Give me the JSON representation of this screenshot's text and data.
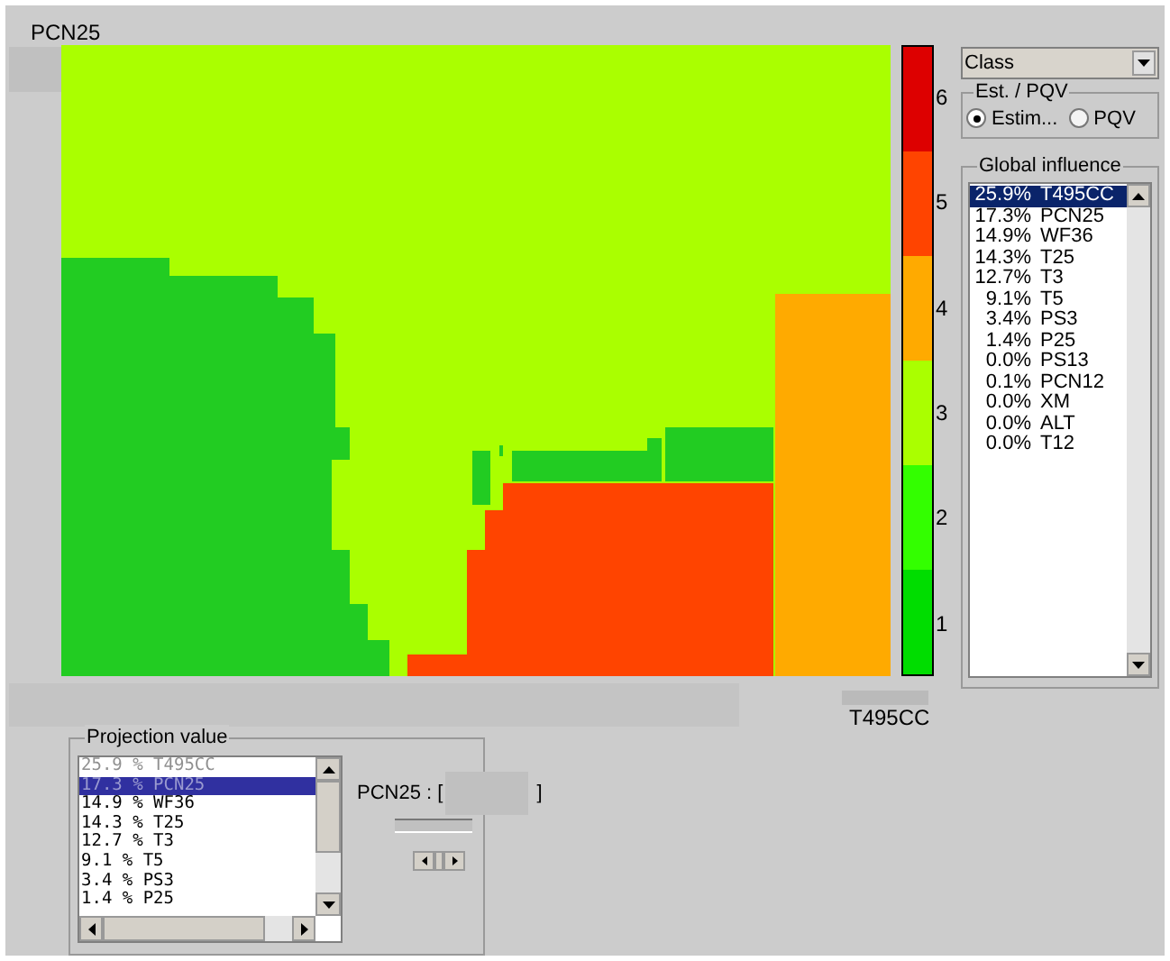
{
  "title": "PCN25",
  "x_axis_label": "T495CC",
  "legend": [
    {
      "label": "6",
      "color": "#dd0000"
    },
    {
      "label": "5",
      "color": "#ff4400"
    },
    {
      "label": "4",
      "color": "#ffaa00"
    },
    {
      "label": "3",
      "color": "#aaff00"
    },
    {
      "label": "2",
      "color": "#33ff00"
    },
    {
      "label": "1",
      "color": "#00dd00"
    }
  ],
  "class_dropdown": {
    "value": "Class"
  },
  "est_pqv": {
    "title": "Est. / PQV",
    "options": [
      {
        "label": "Estim...",
        "selected": true
      },
      {
        "label": "PQV",
        "selected": false
      }
    ]
  },
  "global_influence": {
    "title": "Global influence",
    "items": [
      {
        "percent": "25.9%",
        "name": "T495CC",
        "selected": true
      },
      {
        "percent": "17.3%",
        "name": "PCN25",
        "selected": false
      },
      {
        "percent": "14.9%",
        "name": "WF36",
        "selected": false
      },
      {
        "percent": "14.3%",
        "name": "T25",
        "selected": false
      },
      {
        "percent": "12.7%",
        "name": "T3",
        "selected": false
      },
      {
        "percent": "9.1%",
        "name": "T5",
        "selected": false
      },
      {
        "percent": "3.4%",
        "name": "PS3",
        "selected": false
      },
      {
        "percent": "1.4%",
        "name": "P25",
        "selected": false
      },
      {
        "percent": "0.0%",
        "name": "PS13",
        "selected": false
      },
      {
        "percent": "0.1%",
        "name": "PCN12",
        "selected": false
      },
      {
        "percent": "0.0%",
        "name": "XM",
        "selected": false
      },
      {
        "percent": "0.0%",
        "name": "ALT",
        "selected": false
      },
      {
        "percent": "0.0%",
        "name": "T12",
        "selected": false
      }
    ]
  },
  "projection_value": {
    "title": "Projection value",
    "items": [
      {
        "text": "25.9 % T495CC",
        "selected": false,
        "disabled": true
      },
      {
        "text": "17.3 % PCN25",
        "selected": true,
        "disabled": false
      },
      {
        "text": "14.9 % WF36",
        "selected": false,
        "disabled": false
      },
      {
        "text": "14.3 % T25",
        "selected": false,
        "disabled": false
      },
      {
        "text": "12.7 % T3",
        "selected": false,
        "disabled": false
      },
      {
        "text": "9.1 % T5",
        "selected": false,
        "disabled": false
      },
      {
        "text": "3.4 % PS3",
        "selected": false,
        "disabled": false
      },
      {
        "text": "1.4 % P25",
        "selected": false,
        "disabled": false
      }
    ],
    "field_label": "PCN25 : [",
    "field_close": "]"
  }
}
